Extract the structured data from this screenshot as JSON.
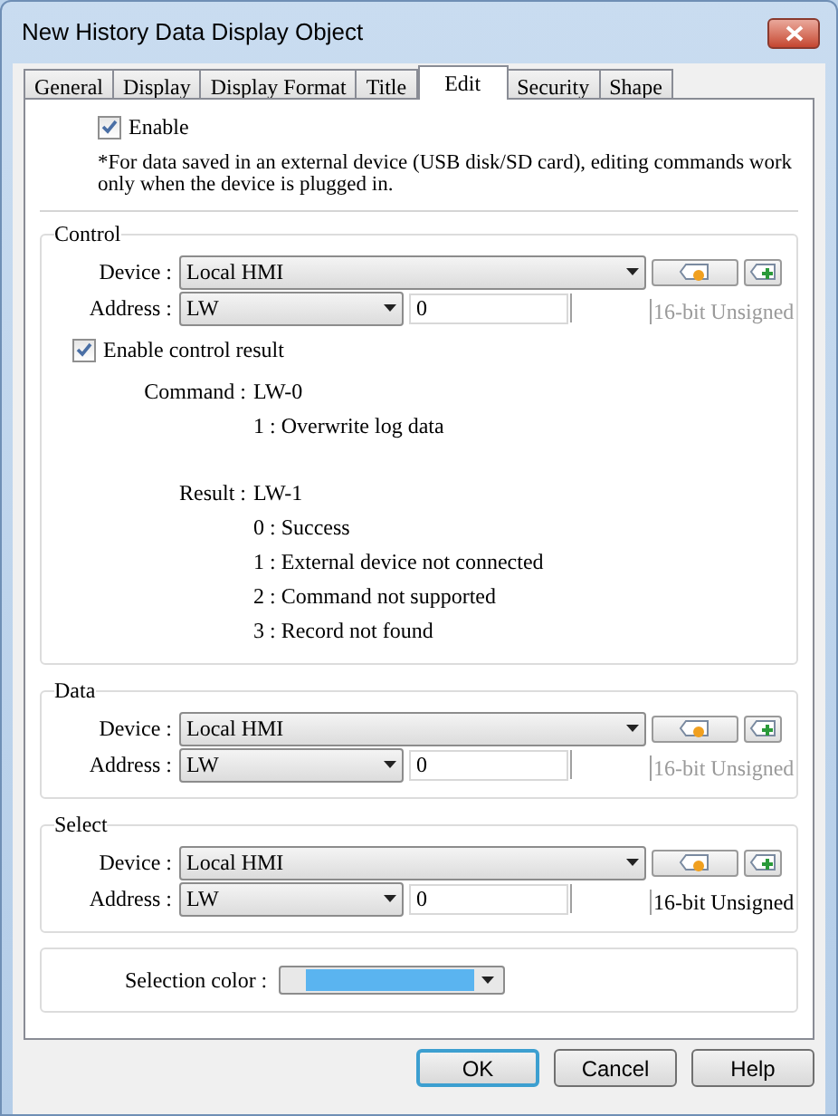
{
  "window": {
    "title": "New History Data Display Object"
  },
  "tabs": [
    {
      "label": "General",
      "selected": false
    },
    {
      "label": "Display",
      "selected": false
    },
    {
      "label": "Display Format",
      "selected": false
    },
    {
      "label": "Title",
      "selected": false
    },
    {
      "label": "Edit",
      "selected": true
    },
    {
      "label": "Security",
      "selected": false
    },
    {
      "label": "Shape",
      "selected": false
    }
  ],
  "enable": {
    "label": "Enable",
    "checked": true
  },
  "note": "*For data saved in an external device (USB disk/SD card), editing commands work only when the device is plugged in.",
  "groups": [
    {
      "title": "Control",
      "device_label": "Device :",
      "device": "Local HMI",
      "address_label": "Address :",
      "address": "LW",
      "address_value": "0",
      "data_type": "16-bit Unsigned",
      "data_type_disabled": true,
      "result_option": {
        "label": "Enable control result",
        "checked": true
      },
      "details": [
        {
          "label": "Command :",
          "lines": [
            "LW-0",
            "1 : Overwrite log data"
          ]
        },
        {
          "label": "Result :",
          "lines": [
            "LW-1",
            "0 : Success",
            "1 : External device not connected",
            "2 : Command not supported",
            "3 : Record not found"
          ]
        }
      ]
    },
    {
      "title": "Data",
      "device_label": "Device :",
      "device": "Local HMI",
      "address_label": "Address :",
      "address": "LW",
      "address_value": "0",
      "data_type": "16-bit Unsigned",
      "data_type_disabled": true
    },
    {
      "title": "Select",
      "device_label": "Device :",
      "device": "Local HMI",
      "address_label": "Address :",
      "address": "LW",
      "address_value": "0",
      "data_type": "16-bit Unsigned",
      "data_type_disabled": false
    }
  ],
  "selection_color": {
    "label": "Selection color :",
    "color": "#5ab4f0"
  },
  "buttons": [
    {
      "label": "OK",
      "default": true
    },
    {
      "label": "Cancel",
      "default": false
    },
    {
      "label": "Help",
      "default": false
    }
  ]
}
